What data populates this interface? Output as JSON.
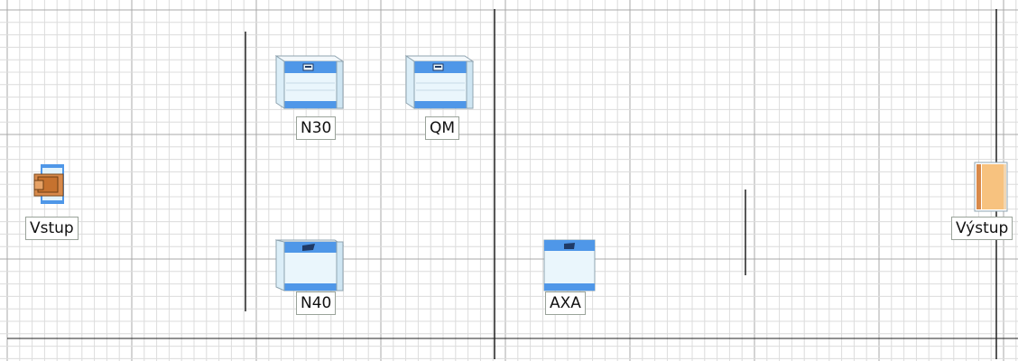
{
  "colors": {
    "grid_minor": "#dcdcdc",
    "grid_major": "#a9a9a9",
    "grid_axis": "#202020",
    "machine_blue": "#4f97e8",
    "machine_light": "#e3f3fb",
    "source_orange": "#c87a3a",
    "sink_orange": "#f7c27f"
  },
  "objects": {
    "source": {
      "label": "Vstup",
      "kind": "source",
      "icon": "box-icon"
    },
    "n30": {
      "label": "N30",
      "kind": "machine",
      "icon": "machine-icon"
    },
    "qm": {
      "label": "QM",
      "kind": "machine",
      "icon": "machine-icon"
    },
    "n40": {
      "label": "N40",
      "kind": "machine",
      "icon": "machine-icon"
    },
    "axa": {
      "label": "AXA",
      "kind": "machine",
      "icon": "machine-icon"
    },
    "sink": {
      "label": "Výstup",
      "kind": "sink",
      "icon": "exit-icon"
    }
  }
}
